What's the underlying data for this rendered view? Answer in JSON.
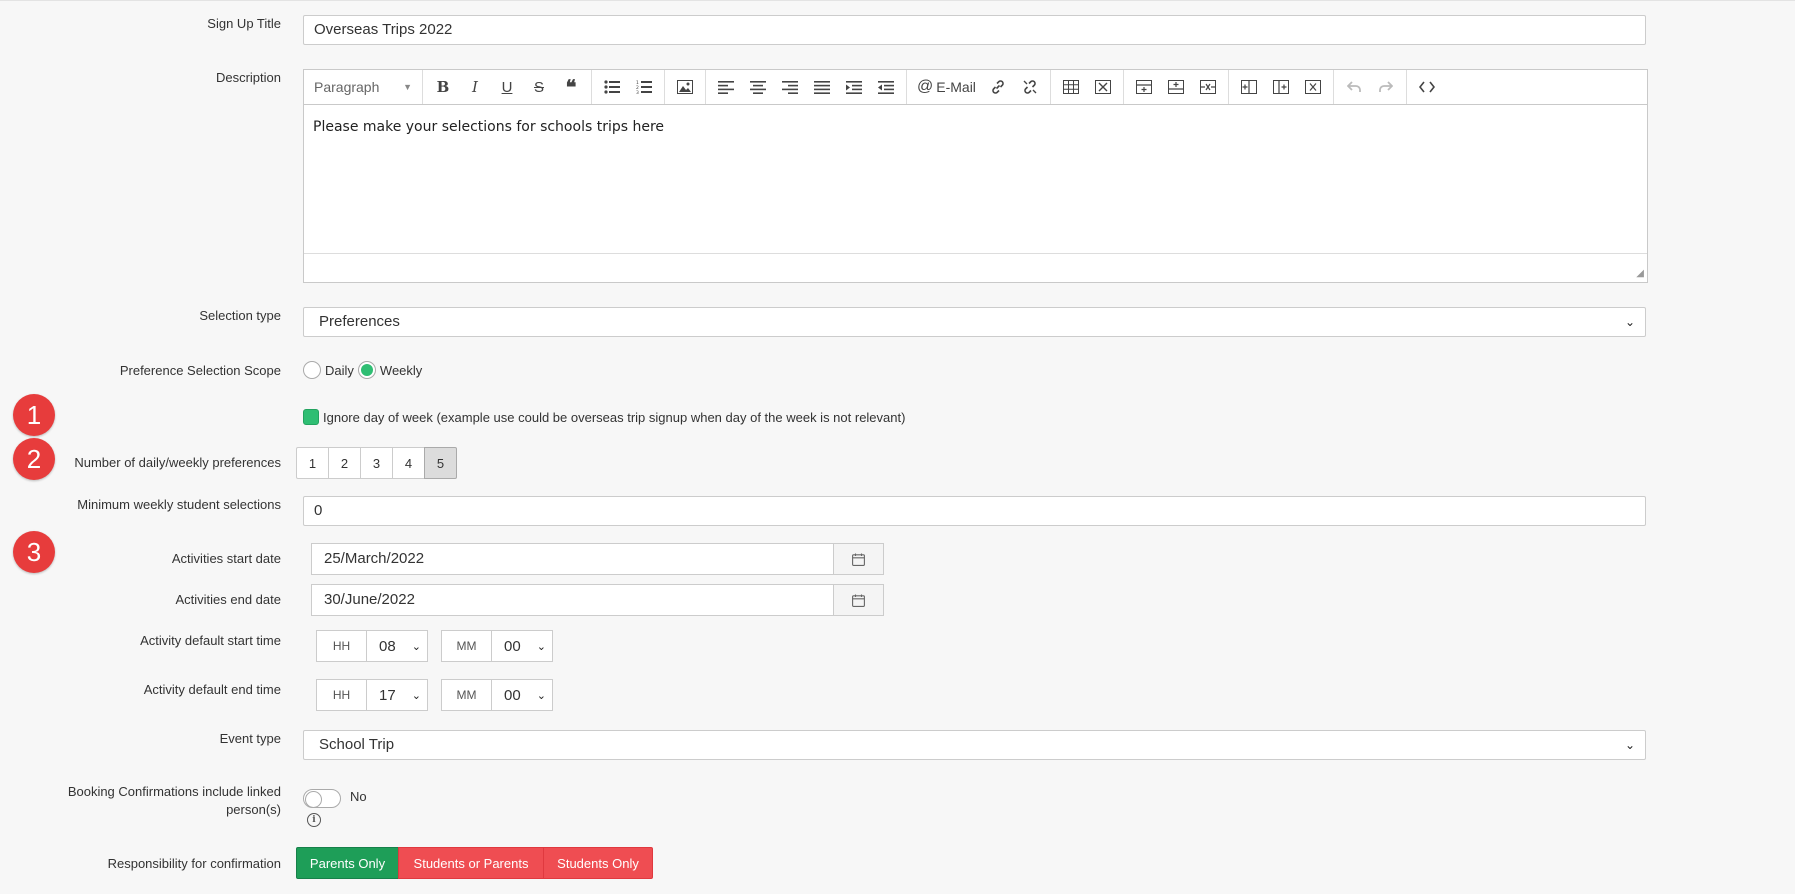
{
  "form": {
    "signup_title": {
      "label": "Sign Up Title",
      "value": "Overseas Trips 2022"
    },
    "description": {
      "label": "Description",
      "toolbar": {
        "block_format": "Paragraph",
        "email_label": "E-Mail"
      },
      "body_text": "Please make your selections for schools trips here"
    },
    "selection_type": {
      "label": "Selection type",
      "value": "Preferences"
    },
    "preference_scope": {
      "label": "Preference Selection Scope",
      "options": [
        {
          "label": "Daily",
          "selected": false
        },
        {
          "label": "Weekly",
          "selected": true
        }
      ]
    },
    "ignore_day": {
      "checked": true,
      "label": "Ignore day of week (example use could be overseas trip signup when day of the week is not relevant)"
    },
    "num_preferences": {
      "label": "Number of daily/weekly preferences",
      "options": [
        "1",
        "2",
        "3",
        "4",
        "5"
      ],
      "selected": "5"
    },
    "min_weekly": {
      "label": "Minimum weekly student selections",
      "value": "0"
    },
    "start_date": {
      "label": "Activities start date",
      "value": "25/March/2022"
    },
    "end_date": {
      "label": "Activities end date",
      "value": "30/June/2022"
    },
    "default_start_time": {
      "label": "Activity default start time",
      "hh_label": "HH",
      "hh": "08",
      "mm_label": "MM",
      "mm": "00"
    },
    "default_end_time": {
      "label": "Activity default end time",
      "hh_label": "HH",
      "hh": "17",
      "mm_label": "MM",
      "mm": "00"
    },
    "event_type": {
      "label": "Event type",
      "value": "School Trip"
    },
    "booking_linked": {
      "label": "Booking Confirmations include linked person(s)",
      "value": "No",
      "enabled": false
    },
    "responsibility": {
      "label": "Responsibility for confirmation",
      "options": [
        "Parents Only",
        "Students or Parents",
        "Students Only"
      ],
      "selected": "Parents Only"
    }
  },
  "markers": [
    "1",
    "2",
    "3"
  ],
  "colors": {
    "accent_green": "#2fbe73",
    "button_green": "#1e9e58",
    "button_red": "#ef4d52",
    "marker_red": "#e73c3c"
  }
}
